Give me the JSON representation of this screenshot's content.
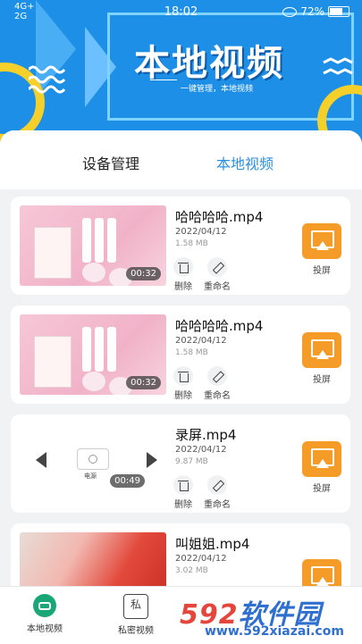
{
  "status_bar": {
    "network": "4G+",
    "network2": "2G",
    "time": "18:02",
    "battery": "72%"
  },
  "hero": {
    "title": "本地视频",
    "subtitle": "一键管理，本地视频"
  },
  "tabs": [
    {
      "label": "设备管理"
    },
    {
      "label": "本地视频"
    }
  ],
  "videos": [
    {
      "title": "哈哈哈哈.mp4",
      "date": "2022/04/12",
      "size": "1.58 MB",
      "duration": "00:32",
      "delete": "删除",
      "rename": "重命名",
      "cast": "投屏"
    },
    {
      "title": "哈哈哈哈.mp4",
      "date": "2022/04/12",
      "size": "1.58 MB",
      "duration": "00:32",
      "delete": "删除",
      "rename": "重命名",
      "cast": "投屏"
    },
    {
      "title": "录屏.mp4",
      "date": "2022/04/12",
      "size": "9.87 MB",
      "duration": "00:49",
      "delete": "删除",
      "rename": "重命名",
      "cast": "投屏",
      "thumb_label": "电源"
    },
    {
      "title": "叫姐姐.mp4",
      "date": "2022/04/12",
      "size": "3.02 MB"
    }
  ],
  "bottom_nav": [
    {
      "label": "本地视频",
      "icon": "video-icon"
    },
    {
      "label": "私密视频",
      "icon": "lock-icon",
      "glyph": "私"
    }
  ],
  "watermark": {
    "logo_part1": "592",
    "logo_part2": "软件园",
    "url": "www.592xiazai.com"
  },
  "colors": {
    "accent": "#2a8fe6",
    "cast": "#f59b27",
    "nav_active": "#1aa777"
  }
}
